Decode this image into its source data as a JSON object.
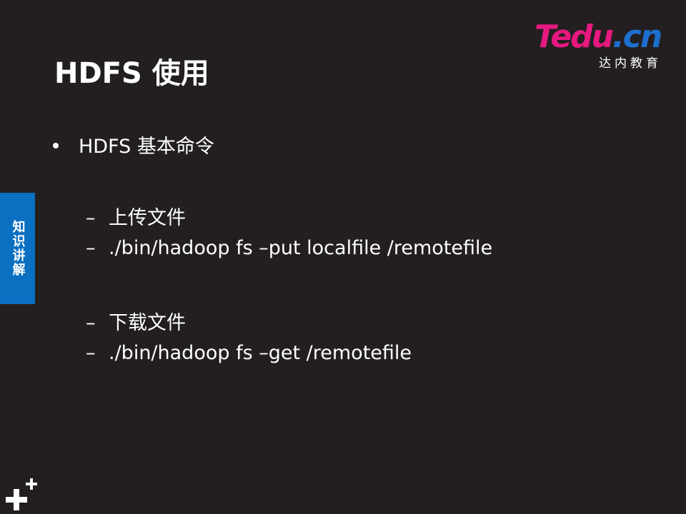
{
  "slide": {
    "title": "HDFS 使用",
    "logo": {
      "brand_t": "T",
      "brand_edu": "edu",
      "brand_dot": ".",
      "brand_cn": "cn",
      "subtitle": "达内教育"
    },
    "side_tab": "知识讲解",
    "bullet": "HDFS 基本命令",
    "sub_items": [
      {
        "dash": "–",
        "text": "上传文件"
      },
      {
        "dash": "–",
        "text": "./bin/hadoop fs –put localfile /remotefile"
      },
      {
        "dash": "–",
        "text": "下载文件"
      },
      {
        "dash": "–",
        "text": "./bin/hadoop fs –get  /remotefile"
      }
    ]
  },
  "colors": {
    "background": "#231f20",
    "tab_blue": "#0b6fc2",
    "logo_pink": "#e6197f",
    "logo_blue": "#1d6fd0"
  }
}
